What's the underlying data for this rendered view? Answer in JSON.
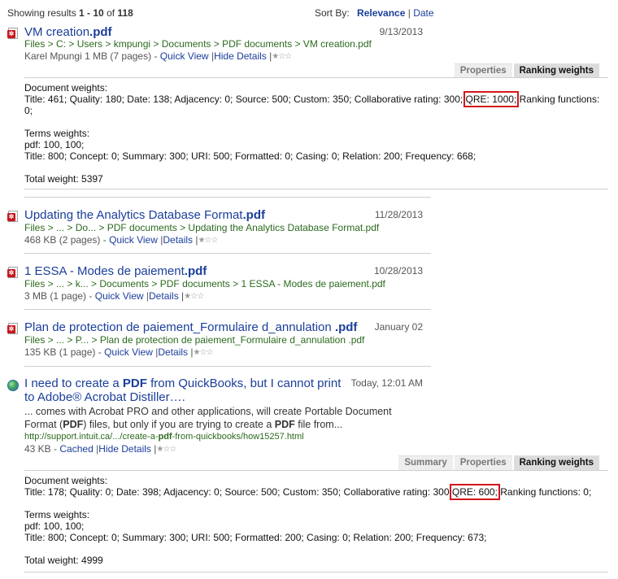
{
  "header": {
    "showing_prefix": "Showing results ",
    "range": "1 - 10",
    "of_word": " of ",
    "total": "118",
    "sort_label": "Sort By:",
    "sort_selected": "Relevance",
    "sort_sep": "|",
    "sort_other": "Date"
  },
  "results": [
    {
      "icon": "pdf-file-icon",
      "title_main": "VM creation",
      "title_ext": ".pdf",
      "date": "9/13/2013",
      "path": "Files > C: > Users > kmpungi > Documents > PDF documents > VM creation.pdf",
      "author": "Karel Mpungi",
      "size": "1 MB (7 pages)",
      "links": [
        "Quick View",
        "Hide Details"
      ],
      "tabs": [
        "Properties",
        "Ranking weights"
      ],
      "active_tab": "Ranking weights",
      "doc_weights_label": "Document weights:",
      "doc_weights_a": "Title: 461; Quality: 180; Date: 138; Adjacency: 0; Source: 500; Custom: 350; Collaborative rating: 300;",
      "qre": "QRE: 1000;",
      "doc_weights_b": "Ranking functions:",
      "doc_weights_c": "0;",
      "terms_label": "Terms weights:",
      "terms_line1": "pdf: 100, 100;",
      "terms_line2": "Title: 800; Concept: 0; Summary: 300; URI: 500; Formatted: 0; Casing: 0; Relation: 200; Frequency: 668;",
      "total_weight": "Total weight: 5397"
    },
    {
      "icon": "pdf-file-icon",
      "title_main": "Updating the Analytics Database Format",
      "title_ext": ".pdf",
      "date": "11/28/2013",
      "path": "Files > ... > Do... > PDF documents > Updating the Analytics Database Format.pdf",
      "size": "468 KB (2 pages)",
      "links": [
        "Quick View",
        "Details"
      ]
    },
    {
      "icon": "pdf-file-icon",
      "title_main": "1 ESSA - Modes de paiement",
      "title_ext": ".pdf",
      "date": "10/28/2013",
      "path": "Files > ... > k... > Documents > PDF documents > 1 ESSA -  Modes de paiement.pdf",
      "size": "3 MB (1 page)",
      "links": [
        "Quick View",
        "Details"
      ]
    },
    {
      "icon": "pdf-file-icon",
      "title_main": "Plan de protection de paiement_Formulaire d_annulation ",
      "title_ext": ".pdf",
      "date": "January 02",
      "path": "Files > ... > P... > Plan de protection de paiement_Formulaire d_annulation .pdf",
      "size": "135 KB (1 page)",
      "links": [
        "Quick View",
        "Details"
      ]
    },
    {
      "icon": "web-page-icon",
      "title_p1": "I need to create a ",
      "title_hl": "PDF",
      "title_p2": " from QuickBooks, but I cannot print",
      "title_line2": "to Adobe® Acrobat Distiller….",
      "date": "Today, 12:01 AM",
      "snippet_line1": "... comes with Acrobat PRO and other applications, will create Portable Document",
      "snippet_line2_a": "Format (",
      "snippet_line2_hl1": "PDF",
      "snippet_line2_b": ") files, but only if you are trying to create a ",
      "snippet_line2_hl2": "PDF",
      "snippet_line2_c": " file from...",
      "url_a": "http://support.intuit.ca/.../create-a-",
      "url_hl": "pdf",
      "url_b": "-from-quickbooks/how15257.html",
      "size": "43 KB",
      "links": [
        "Cached",
        "Hide Details"
      ],
      "tabs": [
        "Summary",
        "Properties",
        "Ranking weights"
      ],
      "active_tab": "Ranking weights",
      "doc_weights_label": "Document weights:",
      "doc_weights_a": "Title: 178; Quality: 0; Date: 398; Adjacency: 0; Source: 500; Custom: 350; Collaborative rating: 300;",
      "qre": "QRE: 600;",
      "doc_weights_b": "Ranking functions: 0;",
      "terms_label": "Terms weights:",
      "terms_line1": "pdf: 100, 100;",
      "terms_line2": "Title: 800; Concept: 0; Summary: 300; URI: 500; Formatted: 200; Casing: 0; Relation: 200; Frequency: 673;",
      "total_weight": "Total weight: 4999"
    }
  ],
  "rating_icon": "star-rating-icon",
  "meta_sep": "-",
  "link_sep": "|",
  "colors": {
    "link": "#1a3e9a",
    "path": "#2b6a1e",
    "highlight_box": "#d3161d"
  }
}
